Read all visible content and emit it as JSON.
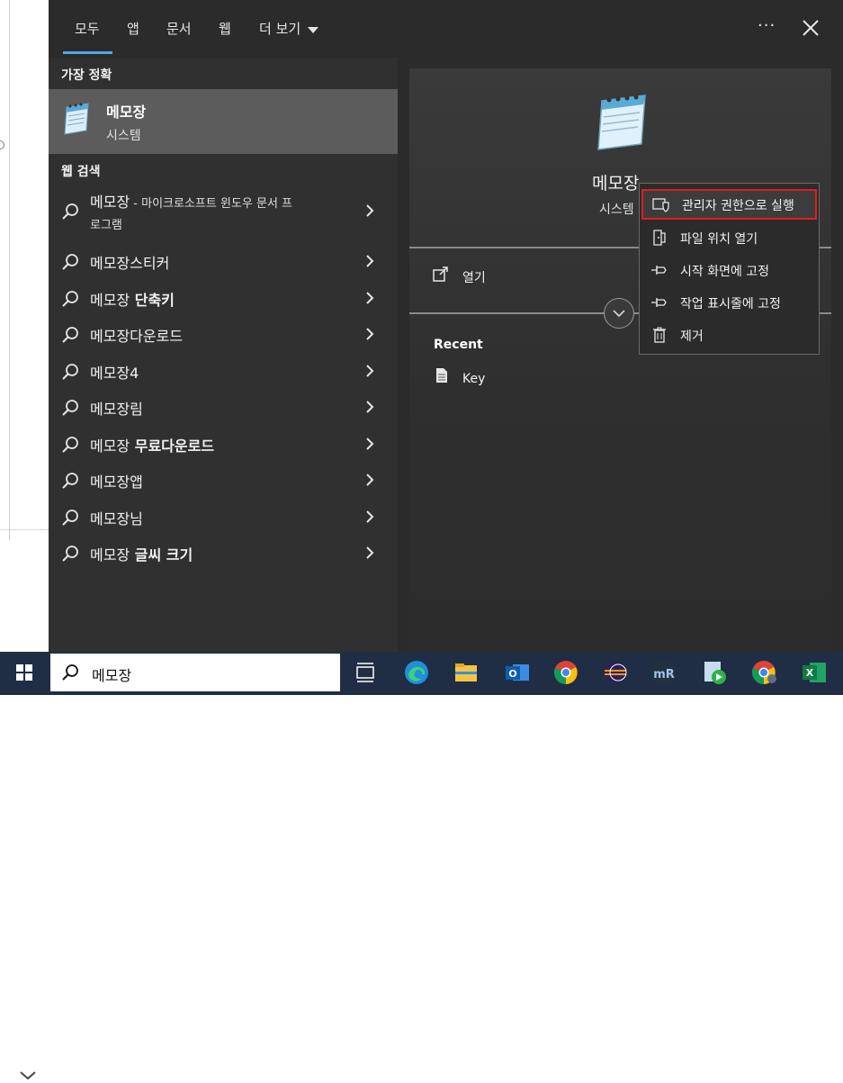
{
  "tabs": [
    {
      "label": "모두",
      "active": true
    },
    {
      "label": "앱"
    },
    {
      "label": "문서"
    },
    {
      "label": "웹"
    },
    {
      "label": "더 보기"
    }
  ],
  "more_options": "···",
  "best_match": {
    "heading": "가장 정확",
    "title": "메모장",
    "subtitle": "시스템"
  },
  "web_search": {
    "heading": "웹 검색",
    "first": {
      "bold": "메모장",
      "rest": " - 마이크로소프트 윈도우 문서 프",
      "line2": "로그램"
    },
    "items": [
      {
        "bold": "메모장스티커",
        "rest": ""
      },
      {
        "bold": "메모장",
        "rest": " 단축키"
      },
      {
        "bold": "메모장다운로드",
        "rest": ""
      },
      {
        "bold": "메모장4",
        "rest": ""
      },
      {
        "bold": "메모장림",
        "rest": ""
      },
      {
        "bold": "메모장",
        "rest": " 무료다운로드"
      },
      {
        "bold": "메모장앱",
        "rest": ""
      },
      {
        "bold": "메모장님",
        "rest": ""
      },
      {
        "bold": "메모장",
        "rest": " 글씨 크기"
      }
    ]
  },
  "detail": {
    "title": "메모장",
    "subtitle": "시스템",
    "open_label": "열기",
    "recent_heading": "Recent",
    "recent_items": [
      "Key"
    ]
  },
  "context_menu": [
    {
      "label": "관리자 권한으로 실행",
      "icon": "shield-icon",
      "highlighted": true
    },
    {
      "label": "파일 위치 열기",
      "icon": "folder-open-icon"
    },
    {
      "label": "시작 화면에 고정",
      "icon": "pin-icon"
    },
    {
      "label": "작업 표시줄에 고정",
      "icon": "pin-icon"
    },
    {
      "label": "제거",
      "icon": "trash-icon"
    }
  ],
  "taskbar": {
    "search_value": "메모장",
    "apps": [
      "task-view",
      "edge",
      "file-explorer",
      "outlook",
      "chrome",
      "eclipse",
      "rstudio",
      "media-player",
      "chrome-profile",
      "excel"
    ]
  },
  "colors": {
    "accent": "#4fa7e8",
    "highlight_border": "#e01e1e",
    "taskbar": "#1f2e44",
    "menu_bg": "#2b2b2b"
  }
}
